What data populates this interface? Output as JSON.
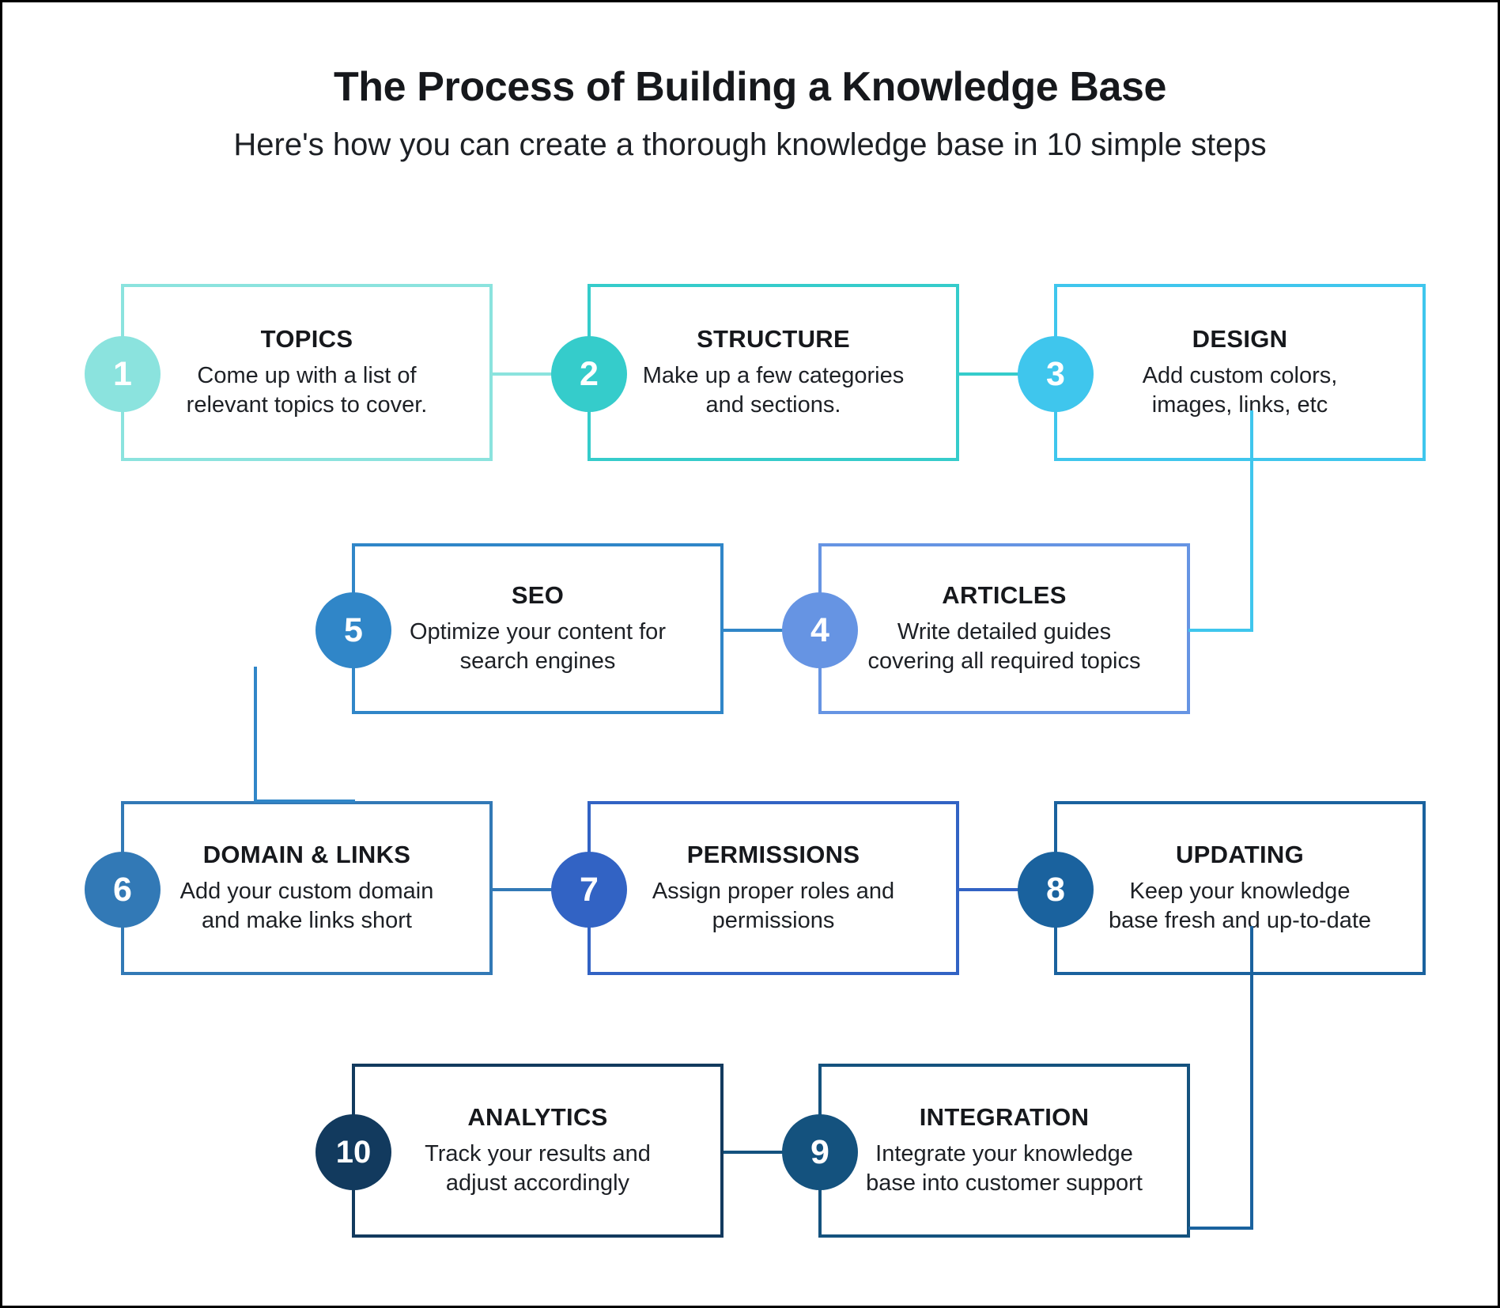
{
  "header": {
    "title": "The Process of Building a Knowledge Base",
    "subtitle": "Here's how you can create a thorough knowledge base in 10 simple steps"
  },
  "palette": {
    "step1": "#8BE3DE",
    "step2": "#35CCCB",
    "step3": "#3FC6ED",
    "step4": "#6694E3",
    "step5": "#3086C8",
    "step6": "#3279B6",
    "step7": "#3263C4",
    "step8": "#1A629E",
    "step9": "#14527E",
    "step10": "#123A5E",
    "title_color": "#16181c",
    "text_color": "#1d2025",
    "background": "#ffffff"
  },
  "steps": [
    {
      "number": "1",
      "title": "TOPICS",
      "desc_line1": "Come up with a list of",
      "desc_line2": "relevant topics to cover."
    },
    {
      "number": "2",
      "title": "STRUCTURE",
      "desc_line1": "Make up a few categories",
      "desc_line2": "and sections."
    },
    {
      "number": "3",
      "title": "DESIGN",
      "desc_line1": "Add custom colors,",
      "desc_line2": "images, links, etc"
    },
    {
      "number": "4",
      "title": "ARTICLES",
      "desc_line1": "Write detailed guides",
      "desc_line2": "covering all required topics"
    },
    {
      "number": "5",
      "title": "SEO",
      "desc_line1": "Optimize your content for",
      "desc_line2": "search engines"
    },
    {
      "number": "6",
      "title": "DOMAIN & LINKS",
      "desc_line1": "Add your custom domain",
      "desc_line2": "and make links short"
    },
    {
      "number": "7",
      "title": "PERMISSIONS",
      "desc_line1": "Assign proper roles and",
      "desc_line2": "permissions"
    },
    {
      "number": "8",
      "title": "UPDATING",
      "desc_line1": "Keep your knowledge",
      "desc_line2": "base fresh and up-to-date"
    },
    {
      "number": "9",
      "title": "INTEGRATION",
      "desc_line1": "Integrate your knowledge",
      "desc_line2": "base into customer support"
    },
    {
      "number": "10",
      "title": "ANALYTICS",
      "desc_line1": "Track your results and",
      "desc_line2": "adjust accordingly"
    }
  ]
}
